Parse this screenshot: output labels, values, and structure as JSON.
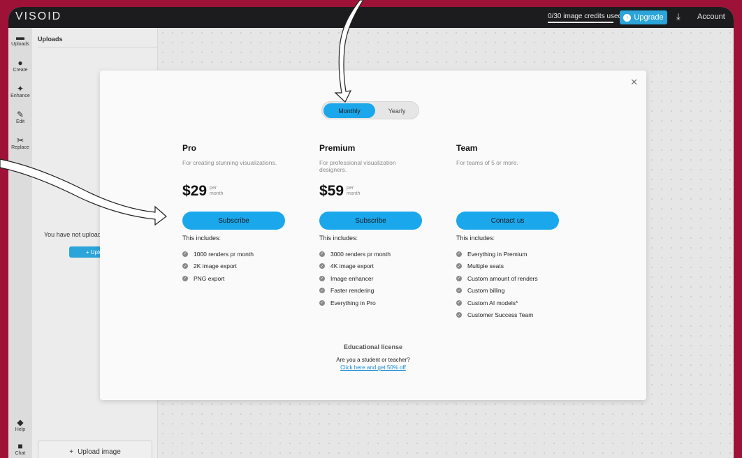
{
  "app": {
    "logo": "VISOID"
  },
  "topbar": {
    "credits_text": "0/30 image credits used",
    "credits_fraction": 0.0,
    "upgrade_label": "Upgrade",
    "download_icon": "download-icon",
    "account_label": "Account"
  },
  "rail": {
    "items": [
      {
        "label": "Uploads",
        "icon": "folder-icon"
      },
      {
        "label": "Create",
        "icon": "bulb-icon"
      },
      {
        "label": "Enhance",
        "icon": "sparkle-icon"
      },
      {
        "label": "Edit",
        "icon": "pencil-icon"
      },
      {
        "label": "Replace",
        "icon": "scissors-icon"
      },
      {
        "label": "Help",
        "icon": "graduation-cap-icon"
      },
      {
        "label": "Chat",
        "icon": "chat-icon"
      }
    ]
  },
  "panel": {
    "title": "Uploads",
    "empty_text": "You have not uploaded",
    "upload_small_label": "+ Upload",
    "upload_image_label": "Upload image"
  },
  "modal": {
    "toggle": {
      "monthly": "Monthly",
      "yearly": "Yearly"
    },
    "plans": [
      {
        "name": "Pro",
        "description": "For creating stunning visualizations.",
        "price": "$29",
        "per": "per",
        "period": "month",
        "button": "Subscribe",
        "includes": "This includes:",
        "features": [
          "1000 renders pr month",
          "2K image export",
          "PNG export"
        ]
      },
      {
        "name": "Premium",
        "description": "For professional visualization designers.",
        "price": "$59",
        "per": "per",
        "period": "month",
        "button": "Subscribe",
        "includes": "This includes:",
        "features": [
          "3000 renders pr month",
          "4K image export",
          "Image enhancer",
          "Faster rendering",
          "Everything in Pro"
        ]
      },
      {
        "name": "Team",
        "description": "For teams of 5 or more.",
        "button": "Contact us",
        "includes": "This includes:",
        "features": [
          "Everything in Premium",
          "Multiple seats",
          "Custom amount of renders",
          "Custom billing",
          "Custom AI models*",
          "Customer Success Team"
        ]
      }
    ],
    "education": {
      "title": "Educational license",
      "question": "Are you a student or teacher?",
      "link": "Click here and get 50% off"
    }
  },
  "colors": {
    "accent": "#1aa7ec",
    "frame": "#9e1237",
    "topbar": "#1c1c1e"
  }
}
